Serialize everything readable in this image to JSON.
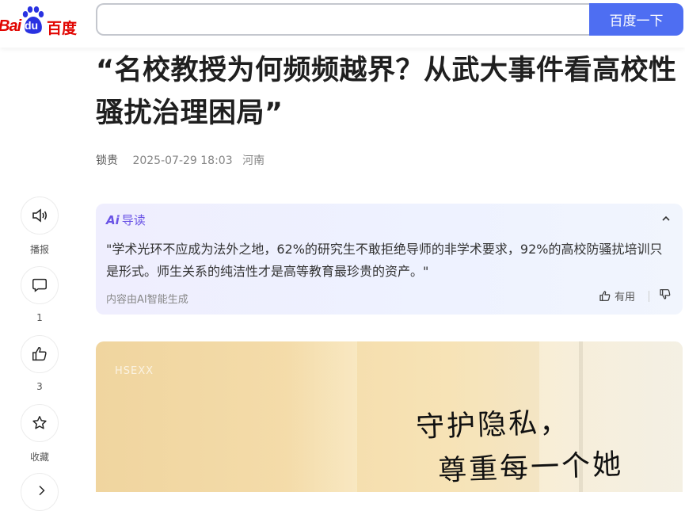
{
  "header": {
    "logo_bai": "Bai",
    "logo_du": "du",
    "logo_cn": "百度",
    "search_value": "",
    "search_button": "百度一下"
  },
  "article": {
    "title": "“名校教授为何频频越界？从武大事件看高校性骚扰治理困局”",
    "author": "锁贵",
    "time": "2025-07-29 18:03",
    "location": "河南"
  },
  "sidebar": {
    "items": [
      {
        "icon": "speaker-icon",
        "label": "播报"
      },
      {
        "icon": "comment-icon",
        "label": "1"
      },
      {
        "icon": "thumbs-up-icon",
        "label": "3"
      },
      {
        "icon": "star-icon",
        "label": "收藏"
      },
      {
        "icon": "share-icon",
        "label": ""
      }
    ]
  },
  "ai_summary": {
    "logo": "Ai",
    "title": "导读",
    "quote": "\"学术光环不应成为法外之地，62%的研究生不敢拒绝导师的非学术要求，92%的高校防骚扰培训只是形式。师生关系的纯洁性才是高等教育最珍贵的资产。\"",
    "footer": "内容由AI智能生成",
    "useful": "有用"
  },
  "image": {
    "faint_text": "HSEXX",
    "line1": "守护隐私，",
    "line2": "尊重每一个她"
  },
  "colors": {
    "brand_red": "#e10602",
    "brand_blue": "#4e6ef2",
    "ai_purple": "#6a53e6"
  }
}
